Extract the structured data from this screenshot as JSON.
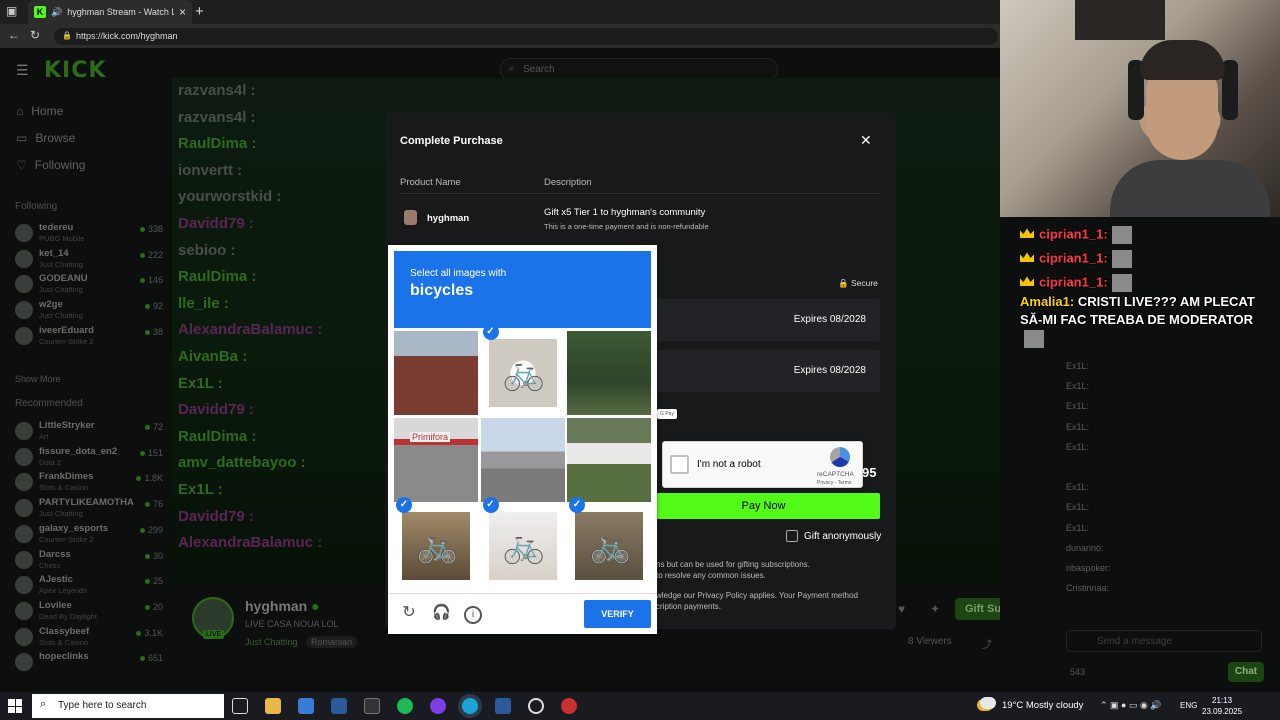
{
  "browser": {
    "tab_title": "hyghman Stream - Watch Li",
    "url": "https://kick.com/hyghman",
    "new_tab": "+",
    "close_tab": "×"
  },
  "kick": {
    "logo": "KICK",
    "search_placeholder": "Search",
    "nav": [
      "Home",
      "Browse",
      "Following"
    ],
    "following_header": "Following",
    "following": [
      {
        "name": "tedereu",
        "category": "PUBG Mobile",
        "viewers": "338"
      },
      {
        "name": "ket_14",
        "category": "Just Chatting",
        "viewers": "222"
      },
      {
        "name": "GODEANU",
        "category": "Just Chatting",
        "viewers": "146"
      },
      {
        "name": "w2ge",
        "category": "Just Chatting",
        "viewers": "92"
      },
      {
        "name": "iveerEduard",
        "category": "Counter-Strike 2",
        "viewers": "38"
      }
    ],
    "show_more": "Show More",
    "recommended_header": "Recommended",
    "recommended": [
      {
        "name": "LittleStryker",
        "category": "Art",
        "viewers": "72"
      },
      {
        "name": "fissure_dota_en2",
        "category": "Dota 2",
        "viewers": "151"
      },
      {
        "name": "FrankDimes",
        "category": "Slots & Casino",
        "viewers": "1.8K"
      },
      {
        "name": "PARTYLIKEAMOTHA",
        "category": "Just Chatting",
        "viewers": "76"
      },
      {
        "name": "galaxy_esports",
        "category": "Counter-Strike 2",
        "viewers": "299"
      },
      {
        "name": "Darcss",
        "category": "Chess",
        "viewers": "30"
      },
      {
        "name": "AJestic",
        "category": "Apex Legends",
        "viewers": "25"
      },
      {
        "name": "Lovilee",
        "category": "Dead By Daylight",
        "viewers": "20"
      },
      {
        "name": "Classybeef",
        "category": "Slots & Casino",
        "viewers": "3.1K"
      },
      {
        "name": "hopeclinks",
        "category": "",
        "viewers": "651"
      }
    ]
  },
  "stream_chat_overlay": [
    "razvans4l : ",
    "razvans4l : ",
    "RaulDima : ",
    "ionvertt : ",
    "yourworstkid : ",
    "Davidd79 : ",
    "sebioo : ",
    "RaulDima : ",
    "lle_ile : ",
    "AlexandraBalamuc : ",
    "AivanBa : ",
    "Ex1L : ",
    "Davidd79 : ",
    "RaulDima : ",
    "amv_dattebayoo : ",
    "Ex1L : ",
    "Davidd79 : ",
    "AlexandraBalamuc : "
  ],
  "stream_info": {
    "streamer": "hyghman",
    "title": "LIVE CASA NOUA LOL",
    "category": "Just Chatting",
    "tag": "Romanian",
    "viewers": "8 Viewers",
    "gift_subs": "Gift Subs",
    "live_badge": "LIVE"
  },
  "right_chat": {
    "overlay_lines": [
      {
        "name": "ciprian1_1:",
        "text": ""
      },
      {
        "name": "ciprian1_1:",
        "text": ""
      },
      {
        "name": "ciprian1_1:",
        "text": ""
      }
    ],
    "amalia_name": "Amalia1:",
    "amalia_text": "CRISTI LIVE??? AM PLECAT SĂ-MI FAC TREABA DE MODERATOR",
    "messages": [
      "Ex1L:",
      "Ex1L:",
      "Ex1L:",
      "Ex1L:",
      "Ex1L:",
      "",
      "Ex1L:",
      "Ex1L:",
      "Ex1L:",
      "dunanno:",
      "nbaspoker:",
      "Cristinnaa:"
    ],
    "send_placeholder": "Send a message",
    "count": "543",
    "chat_button": "Chat"
  },
  "purchase": {
    "title": "Complete Purchase",
    "close": "✕",
    "col_product": "Product Name",
    "col_description": "Description",
    "product": "hyghman",
    "description": "Gift x5 Tier 1 to hyghman's community",
    "description_note": "This is a one-time payment and is non-refundable",
    "secure": "Secure",
    "cards": [
      {
        "expires": "Expires   08/2028"
      },
      {
        "expires": "Expires   08/2028"
      }
    ],
    "gpay": "G Pay",
    "price_tail": "95",
    "pay_now": "Pay Now",
    "gift_anonymously": "Gift anonymously",
    "note1": "ns but can be used for gifting subscriptions.",
    "note2": "to resolve any common issues.",
    "note3": "wledge our Privacy Policy applies. Your Payment method",
    "note4": "cription payments."
  },
  "recaptcha": {
    "label": "I'm not a robot",
    "brand": "reCAPTCHA",
    "links": "Privacy - Terms"
  },
  "captcha": {
    "instruction": "Select all images with",
    "object": "bicycles",
    "verify": "VERIFY",
    "tiles": [
      {
        "label": "building",
        "selected": false
      },
      {
        "label": "bicycle-sign",
        "selected": true
      },
      {
        "label": "trees",
        "selected": false
      },
      {
        "label": "storefront",
        "selected": false
      },
      {
        "label": "street",
        "selected": false
      },
      {
        "label": "parked-vehicles",
        "selected": false
      },
      {
        "label": "bicycle",
        "selected": true
      },
      {
        "label": "bicycle",
        "selected": true
      },
      {
        "label": "bicycle",
        "selected": true
      }
    ],
    "storefront_text": "Primifora"
  },
  "taskbar": {
    "search": "Type here to search",
    "weather": "19°C  Mostly cloudy",
    "lang": "ENG",
    "time": "21:13",
    "date": "23.09.2025"
  }
}
